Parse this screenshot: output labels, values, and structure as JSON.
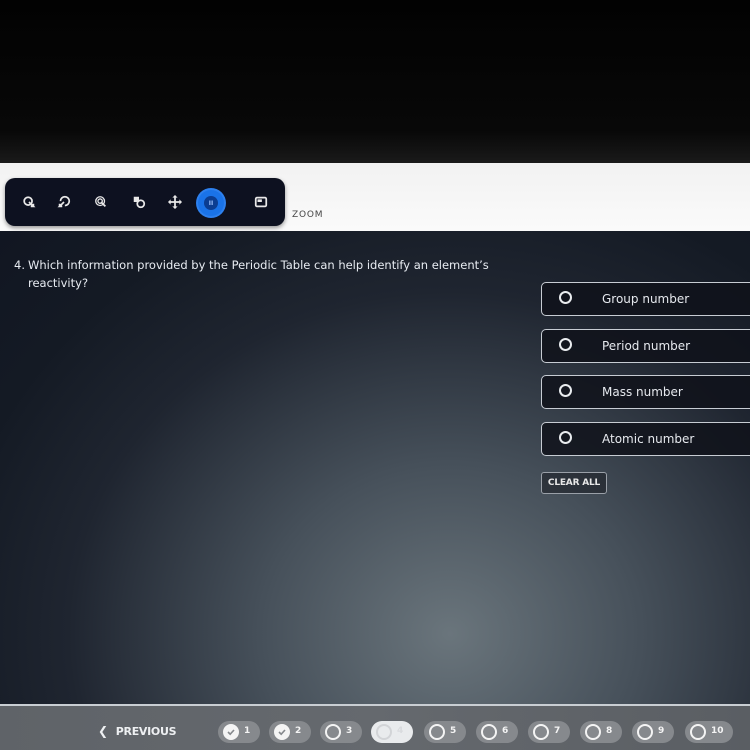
{
  "header": {
    "title_partial": "",
    "zoom_label": "ZOOM"
  },
  "toolbar": {
    "tools": [
      {
        "name": "zoom-in-pointer-icon"
      },
      {
        "name": "rotate-pointer-icon"
      },
      {
        "name": "magnify-pointer-icon"
      },
      {
        "name": "annotate-icon"
      },
      {
        "name": "move-icon"
      },
      {
        "name": "active-tool-icon",
        "active": true
      },
      {
        "name": "window-icon"
      }
    ],
    "accent_color": "#1a73e8"
  },
  "question": {
    "number": "4.",
    "text_line1": "Which information provided by the Periodic Table can help identify an element’s",
    "text_line2": "reactivity?"
  },
  "options": [
    {
      "label": "Group number",
      "selected": false
    },
    {
      "label": "Period number",
      "selected": false
    },
    {
      "label": "Mass number",
      "selected": false
    },
    {
      "label": "Atomic number",
      "selected": false
    }
  ],
  "clear_all_label": "CLEAR ALL",
  "footer": {
    "previous_label": "PREVIOUS",
    "previous_icon": "❮",
    "pages": [
      {
        "n": "1",
        "status": "done"
      },
      {
        "n": "2",
        "status": "done"
      },
      {
        "n": "3",
        "status": "open"
      },
      {
        "n": "4",
        "status": "current"
      },
      {
        "n": "5",
        "status": "open"
      },
      {
        "n": "6",
        "status": "open"
      },
      {
        "n": "7",
        "status": "open"
      },
      {
        "n": "8",
        "status": "open"
      },
      {
        "n": "9",
        "status": "open"
      },
      {
        "n": "10",
        "status": "open"
      }
    ]
  }
}
